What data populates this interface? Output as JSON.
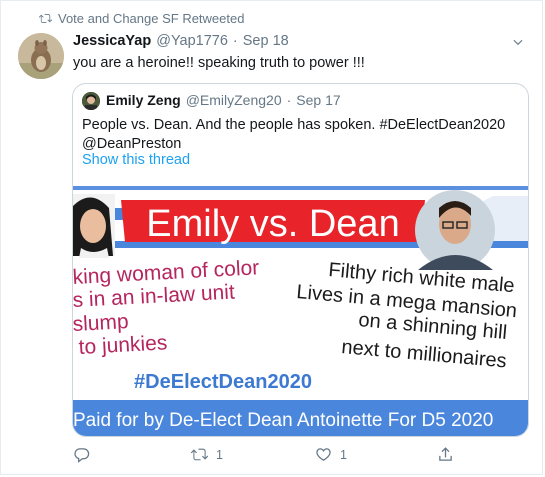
{
  "retweet": {
    "label": "Vote and Change SF Retweeted"
  },
  "tweet": {
    "name": "JessicaYap",
    "handle": "@Yap1776",
    "separator": "·",
    "date": "Sep 18",
    "text": "you are a heroine!!  speaking truth to power !!!"
  },
  "quoted": {
    "name": "Emily Zeng",
    "handle": "@EmilyZeng20",
    "separator": "·",
    "date": "Sep 17",
    "text_line1": "People vs. Dean. And the people has spoken. #DeElectDean2020",
    "text_line2": "@DeanPreston",
    "show_thread": "Show this thread",
    "graphic": {
      "headline": "Emily vs. Dean",
      "left_lines": [
        "king woman of color",
        "s in an in-law unit",
        "slump",
        "to junkies"
      ],
      "right_lines": [
        "Filthy rich white male",
        "Lives in a mega mansion",
        "on a shinning hill",
        "next to millionaires"
      ],
      "hashtag": "#DeElectDean2020",
      "footer": "Paid for by De-Elect Dean Antoinette For D5 2020"
    }
  },
  "actions": {
    "reply_count": "",
    "retweet_count": "1",
    "like_count": "1"
  },
  "colors": {
    "accent": "#1da1f2",
    "banner_red": "#e8232a",
    "banner_blue": "#3b7fd9",
    "left_text": "#b5265f",
    "hashtag": "#3c79d0"
  }
}
